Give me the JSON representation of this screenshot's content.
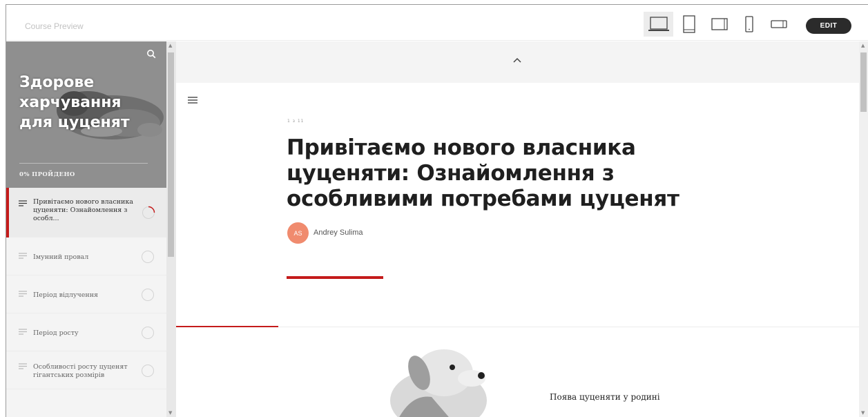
{
  "topbar": {
    "title": "Course Preview",
    "devices": [
      "laptop-icon",
      "tablet-portrait-icon",
      "tablet-landscape-icon",
      "phone-portrait-icon",
      "phone-landscape-icon"
    ],
    "active_device": "laptop-icon",
    "edit_label": "EDIT"
  },
  "sidebar": {
    "course_title": "Здорове харчування для цуценят",
    "progress_label": "0% ПРОЙДЕНО",
    "lessons": [
      {
        "label": "Привітаємо нового власника цуценяти: Ознайомлення з особл...",
        "active": true,
        "status": "in-progress"
      },
      {
        "label": "Імунний провал",
        "active": false,
        "status": "not-started"
      },
      {
        "label": "Період відлучення",
        "active": false,
        "status": "not-started"
      },
      {
        "label": "Період росту",
        "active": false,
        "status": "not-started"
      },
      {
        "label": "Особливості росту цуценят гігантських розмірів",
        "active": false,
        "status": "not-started"
      }
    ]
  },
  "main": {
    "lesson_meta": "1 з 11",
    "lesson_title": "Привітаємо нового власника цуценяти: Ознайомлення з особливими потребами цуценят",
    "author_initials": "AS",
    "author_name": "Andrey Sulima",
    "section_caption": "Поява цуценяти у родині"
  },
  "colors": {
    "accent": "#c41b1b",
    "avatar": "#f08b6e",
    "sidebar_header": "#8f8f8f",
    "edit_button": "#2b2b2b"
  }
}
